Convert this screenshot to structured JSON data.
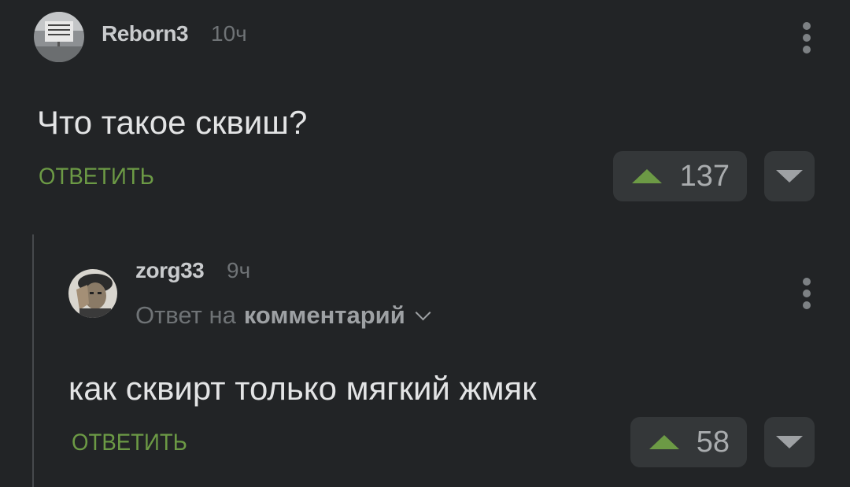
{
  "comments": [
    {
      "author": "Reborn3",
      "time": "10ч",
      "text": "Что такое сквиш?",
      "reply_label": "ОТВЕТИТЬ",
      "rating": "137"
    },
    {
      "author": "zorg33",
      "time": "9ч",
      "reply_to_prefix": "Ответ на",
      "reply_to_link": "комментарий",
      "text": "как сквирт только мягкий жмяк",
      "reply_label": "ОТВЕТИТЬ",
      "rating": "58"
    }
  ],
  "colors": {
    "background": "#222426",
    "accent_green": "#6c9a45",
    "button_bg": "#343739"
  },
  "icons": [
    "more-vertical-icon",
    "upvote-arrow-icon",
    "downvote-arrow-icon",
    "chevron-down-icon"
  ]
}
